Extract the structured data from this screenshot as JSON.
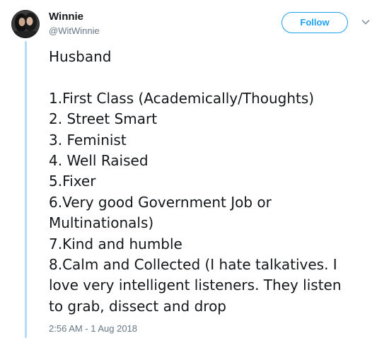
{
  "user": {
    "display_name": "Winnie",
    "handle": "@WitWinnie"
  },
  "actions": {
    "follow_label": "Follow"
  },
  "tweet": {
    "title": "Husband",
    "lines": [
      "1.First Class (Academically/Thoughts)",
      "2. Street Smart",
      "3. Feminist",
      "4. Well Raised",
      "5.Fixer",
      "6.Very good Government Job or",
      "Multinationals)",
      "7.Kind and humble",
      "8.Calm and Collected (I hate talkatives. I",
      "love very intelligent listeners. They listen",
      "to grab, dissect and drop"
    ],
    "timestamp": "2:56 AM - 1 Aug 2018"
  },
  "colors": {
    "accent": "#1da1f2",
    "thread_line": "#b7dcf7",
    "muted_text": "#657786",
    "primary_text": "#14171a"
  },
  "icons": {
    "more": "chevron-down-icon"
  }
}
